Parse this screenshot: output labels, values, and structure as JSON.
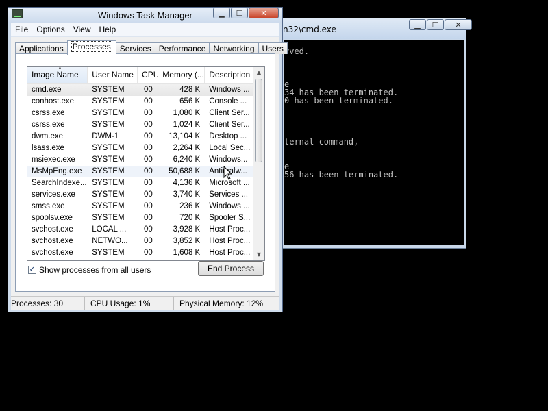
{
  "cmd": {
    "title": "n32\\cmd.exe",
    "lines": [
      "rved.",
      "",
      "",
      "",
      "e",
      "34 has been terminated.",
      "0 has been terminated.",
      "",
      "",
      "",
      "",
      "ternal command,",
      "",
      "",
      "e",
      "56 has been terminated."
    ]
  },
  "taskmgr": {
    "title": "Windows Task Manager",
    "menu": [
      "File",
      "Options",
      "View",
      "Help"
    ],
    "tabs": [
      "Applications",
      "Processes",
      "Services",
      "Performance",
      "Networking",
      "Users"
    ],
    "active_tab": "Processes",
    "columns": [
      "Image Name",
      "User Name",
      "CPU",
      "Memory (...",
      "Description"
    ],
    "sorted_column": "Image Name",
    "rows": [
      {
        "image": "cmd.exe",
        "user": "SYSTEM",
        "cpu": "00",
        "mem": "428 K",
        "desc": "Windows ..."
      },
      {
        "image": "conhost.exe",
        "user": "SYSTEM",
        "cpu": "00",
        "mem": "656 K",
        "desc": "Console ..."
      },
      {
        "image": "csrss.exe",
        "user": "SYSTEM",
        "cpu": "00",
        "mem": "1,080 K",
        "desc": "Client Ser..."
      },
      {
        "image": "csrss.exe",
        "user": "SYSTEM",
        "cpu": "00",
        "mem": "1,024 K",
        "desc": "Client Ser..."
      },
      {
        "image": "dwm.exe",
        "user": "DWM-1",
        "cpu": "00",
        "mem": "13,104 K",
        "desc": "Desktop ..."
      },
      {
        "image": "lsass.exe",
        "user": "SYSTEM",
        "cpu": "00",
        "mem": "2,264 K",
        "desc": "Local Sec..."
      },
      {
        "image": "msiexec.exe",
        "user": "SYSTEM",
        "cpu": "00",
        "mem": "6,240 K",
        "desc": "Windows..."
      },
      {
        "image": "MsMpEng.exe",
        "user": "SYSTEM",
        "cpu": "00",
        "mem": "50,688 K",
        "desc": "Antimalw..."
      },
      {
        "image": "SearchIndexe...",
        "user": "SYSTEM",
        "cpu": "00",
        "mem": "4,136 K",
        "desc": "Microsoft ..."
      },
      {
        "image": "services.exe",
        "user": "SYSTEM",
        "cpu": "00",
        "mem": "3,740 K",
        "desc": "Services ..."
      },
      {
        "image": "smss.exe",
        "user": "SYSTEM",
        "cpu": "00",
        "mem": "236 K",
        "desc": "Windows ..."
      },
      {
        "image": "spoolsv.exe",
        "user": "SYSTEM",
        "cpu": "00",
        "mem": "720 K",
        "desc": "Spooler S..."
      },
      {
        "image": "svchost.exe",
        "user": "LOCAL ...",
        "cpu": "00",
        "mem": "3,928 K",
        "desc": "Host Proc..."
      },
      {
        "image": "svchost.exe",
        "user": "NETWO...",
        "cpu": "00",
        "mem": "3,852 K",
        "desc": "Host Proc..."
      },
      {
        "image": "svchost.exe",
        "user": "SYSTEM",
        "cpu": "00",
        "mem": "1,608 K",
        "desc": "Host Proc..."
      }
    ],
    "selected_row": 0,
    "hover_row": 7,
    "show_all_label": "Show processes from all users",
    "show_all_checked": true,
    "end_process_label": "End Process",
    "status": {
      "processes": "Processes: 30",
      "cpu": "CPU Usage: 1%",
      "memory": "Physical Memory: 12%"
    }
  },
  "icons": {
    "check": "✓",
    "sort_up": "▲",
    "scroll_up": "▲",
    "scroll_down": "▼",
    "minimize": "▁",
    "maximize": "☐",
    "close": "✕"
  }
}
